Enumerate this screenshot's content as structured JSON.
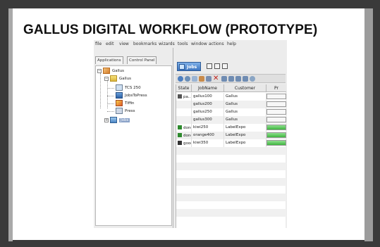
{
  "slide_title": "GALLUS DIGITAL WORKFLOW (PROTOTYPE)",
  "menu": [
    "file",
    "edit",
    "view",
    "bookmarks",
    "wizards",
    "tools",
    "window",
    "actions",
    "help"
  ],
  "left_tabs": [
    "Applications",
    "Control Panel"
  ],
  "tree": {
    "root": "Gallus",
    "folder": "Gallus",
    "children": [
      "TCS 250",
      "JobsToPress",
      "Tiffin",
      "Press"
    ],
    "jobs": "Jobs"
  },
  "jobs_window": {
    "tab_label": "Jobs"
  },
  "table": {
    "columns": [
      "State",
      "JobName",
      "Customer",
      "Pr"
    ],
    "rows": [
      {
        "state": "pa...",
        "state_icon": "pause-icon",
        "job": "gallus100",
        "customer": "Gallus",
        "progress": null
      },
      {
        "state": "",
        "state_icon": "",
        "job": "gallus200",
        "customer": "Gallus",
        "progress": null
      },
      {
        "state": "",
        "state_icon": "",
        "job": "gallus250",
        "customer": "Gallus",
        "progress": null
      },
      {
        "state": "",
        "state_icon": "",
        "job": "gallus300",
        "customer": "Gallus",
        "progress": null
      },
      {
        "state": "done",
        "state_icon": "check-icon",
        "job": "kiwi250",
        "customer": "LabelExpo",
        "progress": 1.0
      },
      {
        "state": "done",
        "state_icon": "check-icon",
        "job": "orange400",
        "customer": "LabelExpo",
        "progress": 1.0
      },
      {
        "state": "good",
        "state_icon": "play-icon",
        "job": "kiwi350",
        "customer": "LabelExpo",
        "progress": 1.0
      }
    ]
  },
  "colors": {
    "frame_dark": "#3a3a3a",
    "selection": "#8aa2c8",
    "progress": "#3fb53f",
    "jobs_tab": "#3e76c0"
  }
}
